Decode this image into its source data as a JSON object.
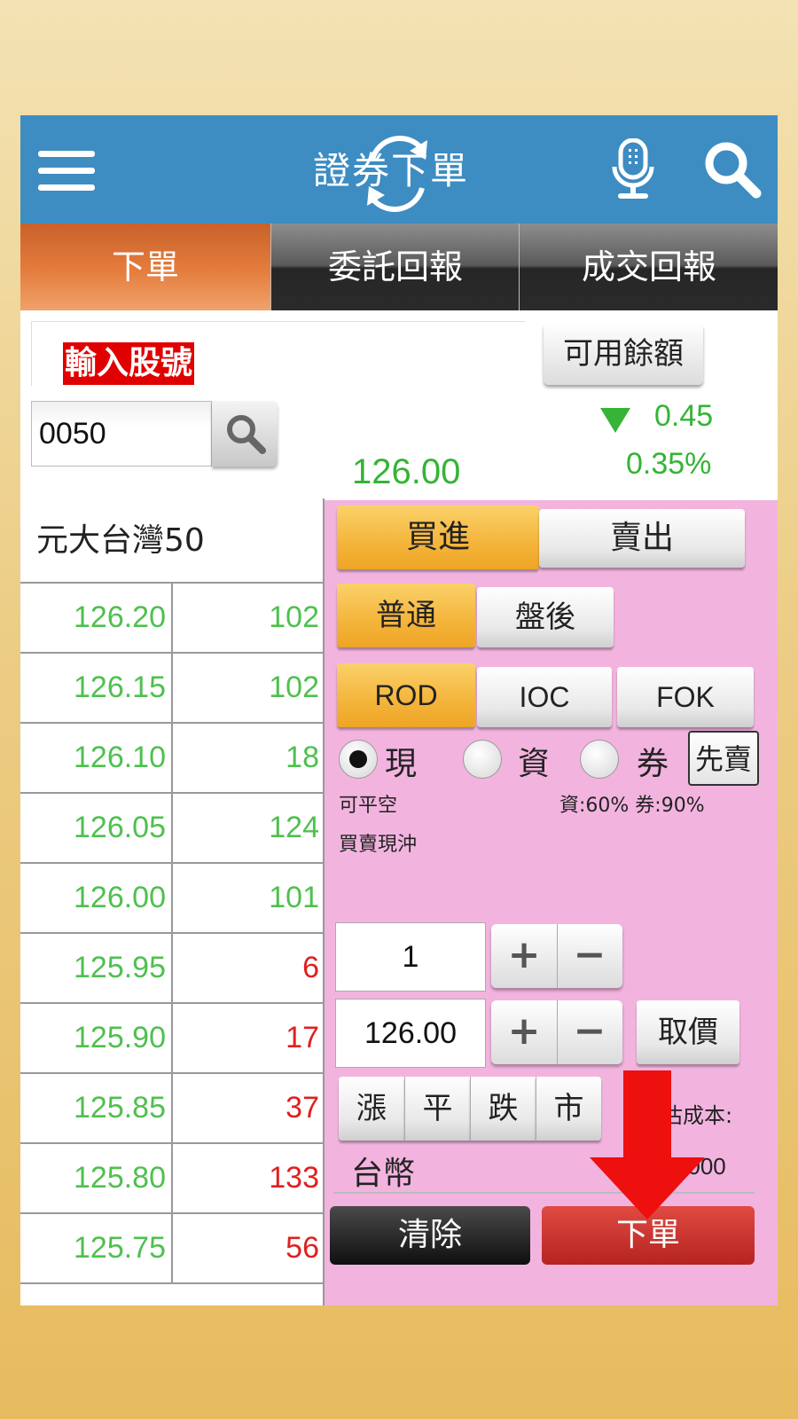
{
  "header": {
    "title": "證券下單",
    "menu_icon": "menu-icon",
    "refresh_icon": "refresh-icon",
    "mic_icon": "microphone-icon",
    "search_icon": "search-icon",
    "color": "#3d8cc2"
  },
  "tabs": [
    {
      "label": "下單",
      "active": true
    },
    {
      "label": "委託回報",
      "active": false
    },
    {
      "label": "成交回報",
      "active": false
    }
  ],
  "stock": {
    "input_label": "輸入股號",
    "code": "0050",
    "name": "元大台灣50",
    "price": "126.00",
    "change": "0.45",
    "change_pct": "0.35%",
    "change_direction": "down"
  },
  "balance_button": "可用餘額",
  "quotes": [
    {
      "price": "126.20",
      "volume": "102",
      "volume_color": "green"
    },
    {
      "price": "126.15",
      "volume": "102",
      "volume_color": "green"
    },
    {
      "price": "126.10",
      "volume": "18",
      "volume_color": "green"
    },
    {
      "price": "126.05",
      "volume": "124",
      "volume_color": "green"
    },
    {
      "price": "126.00",
      "volume": "101",
      "volume_color": "green"
    },
    {
      "price": "125.95",
      "volume": "6",
      "volume_color": "red"
    },
    {
      "price": "125.90",
      "volume": "17",
      "volume_color": "red"
    },
    {
      "price": "125.85",
      "volume": "37",
      "volume_color": "red"
    },
    {
      "price": "125.80",
      "volume": "133",
      "volume_color": "red"
    },
    {
      "price": "125.75",
      "volume": "56",
      "volume_color": "red"
    }
  ],
  "order": {
    "side": {
      "buy": "買進",
      "sell": "賣出",
      "selected": "buy"
    },
    "session": {
      "normal": "普通",
      "after_hours": "盤後",
      "selected": "normal"
    },
    "time_in_force": {
      "rod": "ROD",
      "ioc": "IOC",
      "fok": "FOK",
      "selected": "ROD"
    },
    "trade_type": {
      "cash": "現",
      "margin": "資",
      "short": "券",
      "selected": "cash",
      "sell_first": "先賣"
    },
    "short_allowed": "可平空",
    "margin_ratio": "資:60% 券:90%",
    "day_trade": "買賣現沖",
    "quantity": "1",
    "price": "126.00",
    "get_price_button": "取價",
    "quick_price": [
      "漲",
      "平",
      "跌",
      "市"
    ],
    "cost_label": "估成本:",
    "currency": "台幣",
    "cost_value": "126000",
    "clear_button": "清除",
    "submit_button": "下單"
  },
  "colors": {
    "price_green": "#4fc04f",
    "price_red": "#e02020",
    "panel_pink": "#f2b4df",
    "annotation_red": "#e00000"
  }
}
